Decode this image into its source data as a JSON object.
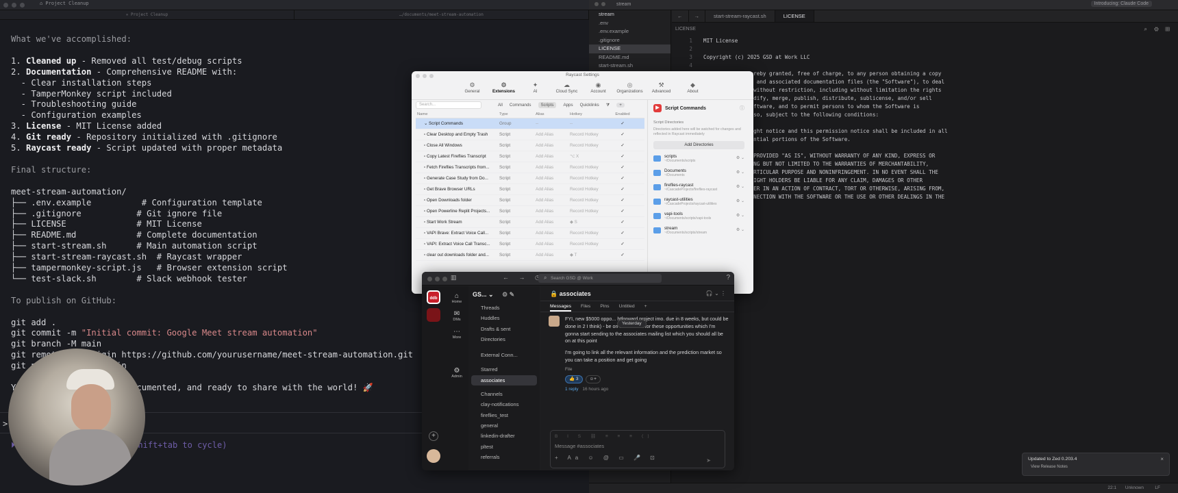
{
  "terminal": {
    "window_title": "⌂ Project Cleanup",
    "tabs": [
      "✳ Project Cleanup",
      "…/documents/meet-stream-automation"
    ],
    "lines": [
      {
        "t": "What we've accomplished:",
        "c": "c-dim"
      },
      {
        "t": "",
        "c": ""
      },
      {
        "seg": [
          {
            "t": "1. "
          },
          {
            "t": "Cleaned up",
            "c": "c-b"
          },
          {
            "t": " - Removed all test/debug scripts"
          }
        ]
      },
      {
        "seg": [
          {
            "t": "2. "
          },
          {
            "t": "Documentation",
            "c": "c-b"
          },
          {
            "t": " - Comprehensive README with:"
          }
        ]
      },
      {
        "t": "  - Clear installation steps"
      },
      {
        "t": "  - TamperMonkey script included"
      },
      {
        "t": "  - Troubleshooting guide"
      },
      {
        "t": "  - Configuration examples"
      },
      {
        "seg": [
          {
            "t": "3. "
          },
          {
            "t": "License",
            "c": "c-b"
          },
          {
            "t": " - MIT License added"
          }
        ]
      },
      {
        "seg": [
          {
            "t": "4. "
          },
          {
            "t": "Git ready",
            "c": "c-b"
          },
          {
            "t": " - Repository initialized with .gitignore"
          }
        ]
      },
      {
        "seg": [
          {
            "t": "5. "
          },
          {
            "t": "Raycast ready",
            "c": "c-b"
          },
          {
            "t": " - Script updated with proper metadata"
          }
        ]
      },
      {
        "t": "",
        "c": ""
      },
      {
        "t": "Final structure:",
        "c": "c-dim"
      },
      {
        "t": "",
        "c": ""
      },
      {
        "t": "meet-stream-automation/"
      },
      {
        "t": "├── .env.example          # Configuration template"
      },
      {
        "t": "├── .gitignore           # Git ignore file"
      },
      {
        "t": "├── LICENSE              # MIT License"
      },
      {
        "t": "├── README.md            # Complete documentation"
      },
      {
        "t": "├── start-stream.sh      # Main automation script"
      },
      {
        "t": "├── start-stream-raycast.sh  # Raycast wrapper"
      },
      {
        "t": "├── tampermonkey-script.js   # Browser extension script"
      },
      {
        "t": "└── test-slack.sh        # Slack webhook tester"
      },
      {
        "t": "",
        "c": ""
      },
      {
        "t": "To publish on GitHub:",
        "c": "c-dim"
      },
      {
        "t": "",
        "c": ""
      },
      {
        "t": "git add ."
      },
      {
        "seg": [
          {
            "t": "git commit -m "
          },
          {
            "t": "\"Initial commit: Google Meet stream automation\"",
            "c": "c-str"
          }
        ]
      },
      {
        "t": "git branch -M main"
      },
      {
        "t": "git remote add origin https://github.com/yourusername/meet-stream-automation.git"
      },
      {
        "t": "git push -u origin main"
      },
      {
        "t": "",
        "c": ""
      },
      {
        "t": "Your project is clean, documented, and ready to share with the world! 🚀"
      }
    ],
    "prompt": ">",
    "hint": "⏵⏵ auto-accept edits on (shift+tab to cycle)"
  },
  "editor": {
    "project": "stream",
    "notice": "Introducing: Claude Code",
    "files": [
      ".env",
      ".env.example",
      ".gitignore",
      "LICENSE",
      "README.md",
      "start-stream.sh"
    ],
    "selected_file": "LICENSE",
    "tabs": [
      "start-stream-raycast.sh",
      "LICENSE"
    ],
    "breadcrumb": "LICENSE",
    "code": [
      "MIT License",
      "",
      "Copyright (c) 2025 GSD at Work LLC",
      "",
      "Permission is hereby granted, free of charge, to any person obtaining a copy",
      "of this software and associated documentation files (the \"Software\"), to deal",
      "in the Software without restriction, including without limitation the rights",
      "to use, copy, modify, merge, publish, distribute, sublicense, and/or sell",
      "copies of the Software, and to permit persons to whom the Software is",
      "furnished to do so, subject to the following conditions:",
      "",
      "The above copyright notice and this permission notice shall be included in all",
      "copies or substantial portions of the Software.",
      "",
      "THE SOFTWARE IS PROVIDED \"AS IS\", WITHOUT WARRANTY OF ANY KIND, EXPRESS OR",
      "IMPLIED, INCLUDING BUT NOT LIMITED TO THE WARRANTIES OF MERCHANTABILITY,",
      "FITNESS FOR A PARTICULAR PURPOSE AND NONINFRINGEMENT. IN NO EVENT SHALL THE",
      "AUTHORS OR COPYRIGHT HOLDERS BE LIABLE FOR ANY CLAIM, DAMAGES OR OTHER",
      "LIABILITY, WHETHER IN AN ACTION OF CONTRACT, TORT OR OTHERWISE, ARISING FROM,",
      "OUT OF OR IN CONNECTION WITH THE SOFTWARE OR THE USE OR OTHER DEALINGS IN THE",
      "SOFTWARE.",
      ""
    ],
    "status_pos": "22:1",
    "status_lang": "Unknown",
    "status_enc": "LF"
  },
  "raycast": {
    "title": "Raycast Settings",
    "nav": [
      {
        "label": "General",
        "icon": "⚙"
      },
      {
        "label": "Extensions",
        "icon": "⚙",
        "active": true
      },
      {
        "label": "AI",
        "icon": "✦"
      },
      {
        "label": "Cloud Sync",
        "icon": "☁"
      },
      {
        "label": "Account",
        "icon": "◉"
      },
      {
        "label": "Organizations",
        "icon": "◎"
      },
      {
        "label": "Advanced",
        "icon": "⚒"
      },
      {
        "label": "About",
        "icon": "◆"
      }
    ],
    "search_placeholder": "Search...",
    "filters": [
      "All",
      "Commands",
      "Scripts",
      "Apps",
      "Quicklinks"
    ],
    "columns": [
      "Name",
      "Type",
      "Alias",
      "Hotkey",
      "Enabled"
    ],
    "rows": [
      {
        "name": "Script Commands",
        "type": "Group",
        "alias": "--",
        "hotkey": "--",
        "sel": true
      },
      {
        "name": "Clear Desktop and Empty Trash",
        "type": "Script",
        "alias": "Add Alias",
        "hotkey": "Record Hotkey"
      },
      {
        "name": "Close All Windows",
        "type": "Script",
        "alias": "Add Alias",
        "hotkey": "Record Hotkey"
      },
      {
        "name": "Copy Latest Fireflies Transcript",
        "type": "Script",
        "alias": "Add Alias",
        "hotkey": "⌥ X"
      },
      {
        "name": "Fetch Fireflies Transcripts from...",
        "type": "Script",
        "alias": "Add Alias",
        "hotkey": "Record Hotkey"
      },
      {
        "name": "Generate Case Study from Do...",
        "type": "Script",
        "alias": "Add Alias",
        "hotkey": "Record Hotkey"
      },
      {
        "name": "Get Brave Browser URLs",
        "type": "Script",
        "alias": "Add Alias",
        "hotkey": "Record Hotkey"
      },
      {
        "name": "Open Downloads folder",
        "type": "Script",
        "alias": "Add Alias",
        "hotkey": "Record Hotkey"
      },
      {
        "name": "Open Powerline Replit Projects...",
        "type": "Script",
        "alias": "Add Alias",
        "hotkey": "Record Hotkey"
      },
      {
        "name": "Start Work Stream",
        "type": "Script",
        "alias": "Add Alias",
        "hotkey": "◆ S"
      },
      {
        "name": "VAPI Brave: Extract Voice Call...",
        "type": "Script",
        "alias": "Add Alias",
        "hotkey": "Record Hotkey"
      },
      {
        "name": "VAPI: Extract Voice Call Transc...",
        "type": "Script",
        "alias": "Add Alias",
        "hotkey": "Record Hotkey"
      },
      {
        "name": "clear out downloads folder and...",
        "type": "Script",
        "alias": "Add Alias",
        "hotkey": "◆ T"
      }
    ],
    "detail_title": "Script Commands",
    "dir_label": "Script Directories",
    "dir_desc": "Directories added here will be watched for changes and reflected in Raycast immediately",
    "add_dir": "Add Directories",
    "dirs": [
      {
        "name": "scripts",
        "path": "~/Documents/scripts"
      },
      {
        "name": "Documents",
        "path": "~/Documents"
      },
      {
        "name": "fireflies-raycast",
        "path": "~/CascadeProjects/fireflies-raycast"
      },
      {
        "name": "raycast-utilities",
        "path": "~/CascadeProjects/raycast-utilities"
      },
      {
        "name": "vapi-tools",
        "path": "~/Documents/scripts/vapi-tools"
      },
      {
        "name": "stream",
        "path": "~/Documents/scripts/stream"
      }
    ]
  },
  "slack": {
    "search": "Search GSD @ Work",
    "workspace": "GS...",
    "rail": [
      "Home",
      "DMs",
      "More",
      "Admin"
    ],
    "nav": [
      "Threads",
      "Huddles",
      "Drafts & sent",
      "Directories"
    ],
    "sections": [
      "External Conn...",
      "Starred"
    ],
    "starred": "associates",
    "channels_label": "Channels",
    "channels": [
      "clay-notifications",
      "fireflies_test",
      "general",
      "linkedin-drafter",
      "pltest",
      "referrals"
    ],
    "channel_title": "associates",
    "tabs": [
      "Messages",
      "Files",
      "Pins",
      "Untitled"
    ],
    "msg1": "FYI, new $5000 oppo... htforward project imo. due in 8 weeks, but could be done in 2 I think) - be on the lookout for these opportunities which I'm gonna start sending to the associates mailing list which you should all be on at this point",
    "date_pill": "Yesterday",
    "msg2": "I'm going to link all the relevant information and the prediction market so you can take a position and get going",
    "file": "File",
    "reaction": "👍 3",
    "reply": "1 reply",
    "reply_time": "16 hours ago",
    "compose": "Message #associates"
  },
  "toast": {
    "title": "Updated to Zed 0.203.4",
    "link": "View Release Notes"
  }
}
